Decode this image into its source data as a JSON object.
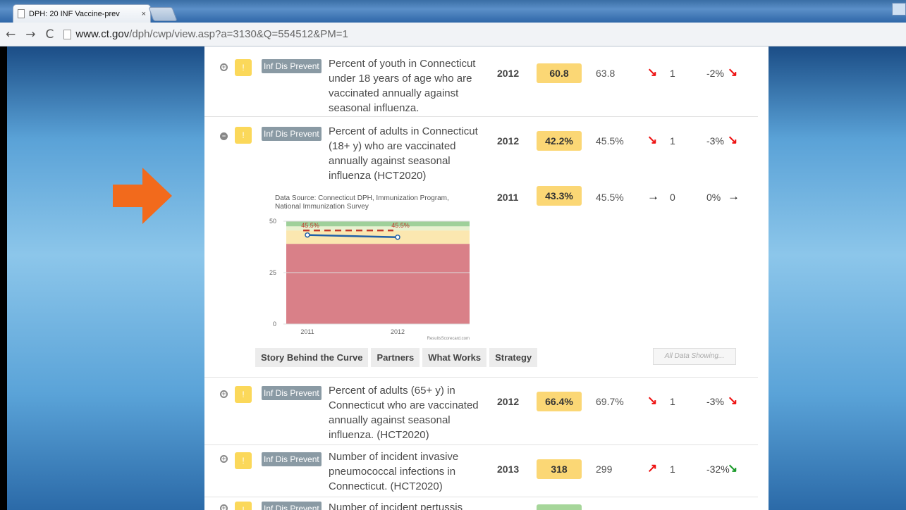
{
  "browser": {
    "tab_title": "DPH: 20 INF Vaccine-prev",
    "tab_close": "×",
    "url_domain": "www.ct.gov",
    "url_path": "/dph/cwp/view.asp?a=3130&Q=554512&PM=1",
    "nav": {
      "back": "←",
      "forward": "→",
      "reload": "C"
    }
  },
  "rows": [
    {
      "toggle": "+",
      "tag": "Inf Dis Prevent",
      "description": "Percent of youth in Connecticut under 18 years of age who are vaccinated annually against seasonal influenza.",
      "year": "2012",
      "value": "60.8",
      "target": "63.8",
      "trend_count": "1",
      "percent_change": "-2%",
      "value_color": "#fbd775"
    },
    {
      "toggle": "−",
      "tag": "Inf Dis Prevent",
      "description": "Percent of adults in Connecticut (18+ y) who are vaccinated annually against seasonal influenza (HCT2020)",
      "year": "2012",
      "value": "42.2%",
      "target": "45.5%",
      "trend_count": "1",
      "percent_change": "-3%",
      "value_color": "#fbd775",
      "sub": {
        "year": "2011",
        "value": "43.3%",
        "target": "45.5%",
        "trend_count": "0",
        "percent_change": "0%"
      }
    },
    {
      "toggle": "+",
      "tag": "Inf Dis Prevent",
      "description": "Percent of adults (65+ y) in Connecticut who are vaccinated annually against seasonal influenza. (HCT2020)",
      "year": "2012",
      "value": "66.4%",
      "target": "69.7%",
      "trend_count": "1",
      "percent_change": "-3%",
      "value_color": "#fbd775"
    },
    {
      "toggle": "+",
      "tag": "Inf Dis Prevent",
      "description": "Number of incident invasive pneumococcal infections in Connecticut. (HCT2020)",
      "year": "2013",
      "value": "318",
      "target": "299",
      "trend_count": "1",
      "percent_change": "-32%",
      "value_color": "#fbd775"
    },
    {
      "toggle": "+",
      "tag": "Inf Dis Prevent",
      "description": "Number of incident pertussis",
      "value_color": "#a6d69a"
    }
  ],
  "chart_data": {
    "type": "line",
    "source": "Data Source: Connecticut DPH, Immunization Program, National Immunization Survey",
    "watermark": "ResultsScorecard.com",
    "x": [
      "2011",
      "2012"
    ],
    "series": [
      {
        "values": [
          43.3,
          42.2
        ]
      }
    ],
    "target_line": {
      "values": [
        45.5,
        45.5
      ],
      "labels": [
        "45.5%",
        "45.5%"
      ]
    },
    "bands": [
      {
        "from": 0,
        "to": 39,
        "color": "#d98088"
      },
      {
        "from": 39,
        "to": 45.5,
        "color": "#fbe7b0"
      },
      {
        "from": 45.5,
        "to": 47.5,
        "color": "#e8f1cf"
      },
      {
        "from": 47.5,
        "to": 50,
        "color": "#9fd09a"
      }
    ],
    "yticks": [
      "0",
      "25",
      "50"
    ],
    "ylim": [
      0,
      50
    ]
  },
  "story_tabs": [
    "Story Behind the Curve",
    "Partners",
    "What Works",
    "Strategy"
  ],
  "all_data": "All Data Showing...",
  "colors": {
    "arrow": "#f26a1c",
    "warn": "#fbd85a",
    "tag": "#8a9aa4"
  }
}
